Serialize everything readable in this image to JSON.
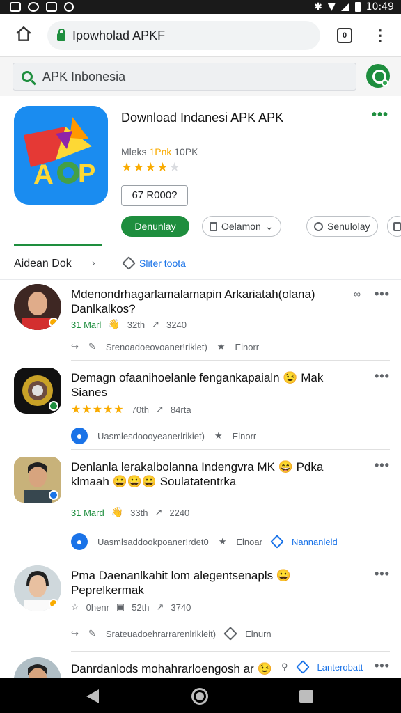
{
  "status_bar": {
    "time": "10:49"
  },
  "url_bar": {
    "url_text": "Ipowholad APKF",
    "tab_count": "0"
  },
  "search": {
    "query": "APK Inbonesia"
  },
  "app": {
    "title": "Download Indanesi APK APK",
    "meta_prefix": "Mleks",
    "meta_highlight": "1Pnk",
    "meta_suffix": "10PK",
    "rating_stars": 4,
    "size_label": "67 R000?",
    "download_label": "Denunlay",
    "option_1_label": "Oelamon",
    "option_2_label": "Senulolay"
  },
  "section": {
    "title": "Aidean Dok",
    "filter_label": "Sliter toota"
  },
  "reviews": [
    {
      "title": "Mdenondrhagarlamalamapin Arkariatah(olana) Danlkalkos?",
      "date": "31 Marl",
      "stat_1": "32th",
      "stat_2": "3240",
      "action_text": "Srenoadoeovoaner!riklet)",
      "action_extra": "Einorr"
    },
    {
      "title": "Demagn ofaanihoelanle fengankapaialn 😉 Mak Sianes",
      "stars": 5,
      "stat_1": "70th",
      "stat_2": "84rta",
      "action_text": "Uasmlesdoooyeanerlrikiet)",
      "action_extra": "Elnorr"
    },
    {
      "title": "Denlanla lerakalbolanna Indengvra MK 😄 Pdka klmaah 😀😀😀 Soulatatentrka",
      "date": "31 Mard",
      "stat_1": "33th",
      "stat_2": "2240",
      "action_text": "Uasmlsaddookpoaner!rdet0",
      "action_extra": "Elnoar",
      "action_link": "Nannanleld"
    },
    {
      "title": "Pma Daenanlkahit lom alegentsenapls 😀 Peprelkermak",
      "date": "0henr",
      "stat_1": "52th",
      "stat_2": "3740",
      "action_text": "Srateuadoehrarrarenlrikleit)",
      "action_extra": "Elnurn"
    },
    {
      "title": "Danrdanlods mohahrarloengosh ar 😉",
      "action_link": "Lanterobatt"
    }
  ]
}
